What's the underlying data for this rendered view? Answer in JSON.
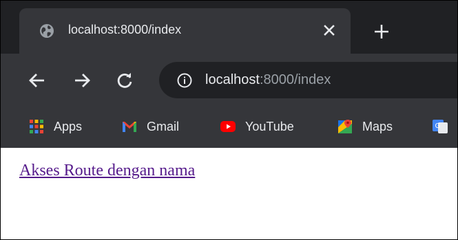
{
  "tab": {
    "title": "localhost:8000/index",
    "favicon": "globe-icon",
    "close": "close-icon"
  },
  "new_tab": "plus-icon",
  "toolbar": {
    "back": "arrow-left-icon",
    "forward": "arrow-right-icon",
    "reload": "reload-icon"
  },
  "address": {
    "info_icon": "info-icon",
    "host": "localhost",
    "rest": ":8000/index"
  },
  "bookmarks": [
    {
      "label": "Apps",
      "icon": "apps-grid-icon"
    },
    {
      "label": "Gmail",
      "icon": "gmail-icon"
    },
    {
      "label": "YouTube",
      "icon": "youtube-icon"
    },
    {
      "label": "Maps",
      "icon": "maps-icon"
    },
    {
      "label": "",
      "icon": "google-translate-icon"
    }
  ],
  "page": {
    "link_text": "Akses Route dengan nama"
  },
  "colors": {
    "tabstrip_bg": "#202124",
    "toolbar_bg": "#35363a",
    "omnibox_bg": "#202124",
    "text_light": "#e8eaed",
    "text_dim": "#9aa0a6",
    "visited_link": "#551a8b"
  }
}
